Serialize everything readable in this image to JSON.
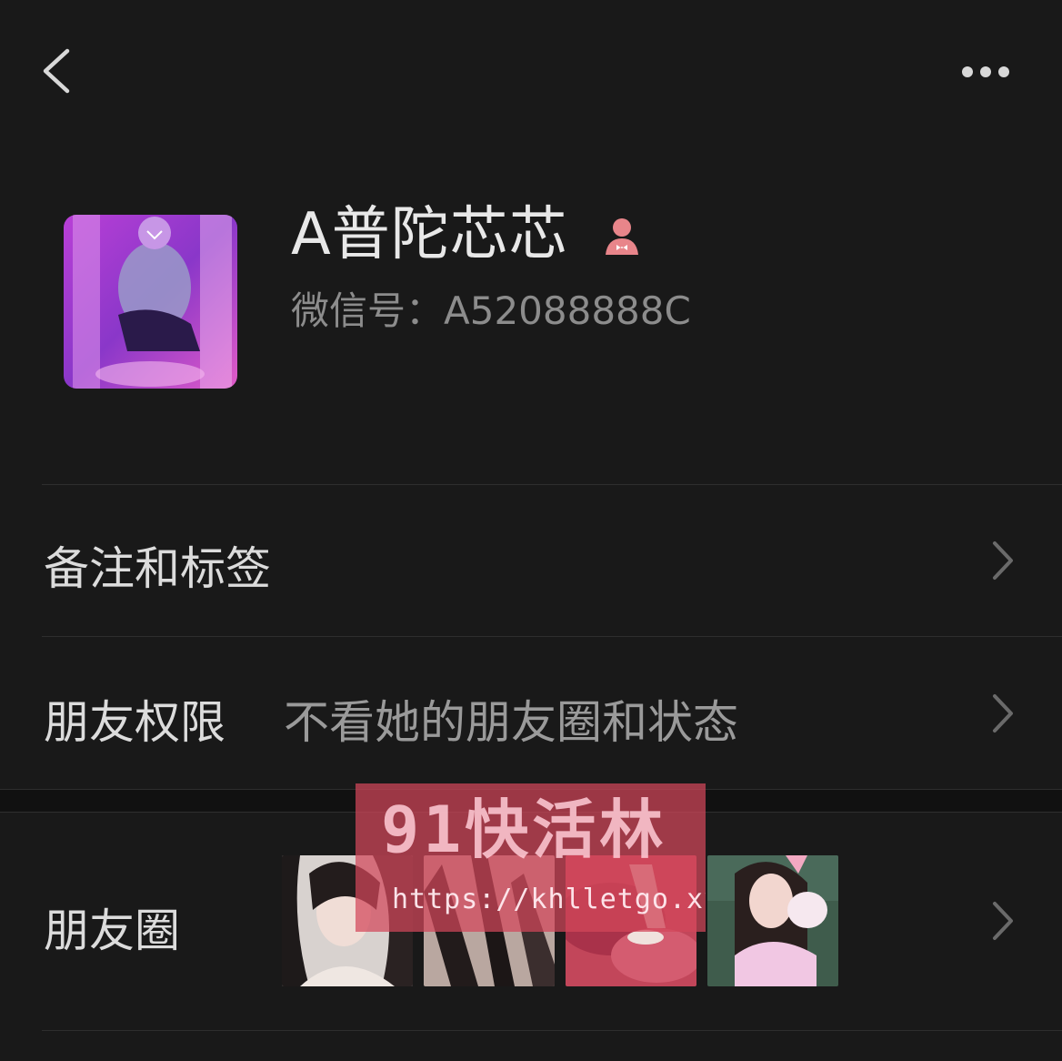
{
  "header": {
    "back_icon": "chevron-left-icon",
    "more_icon": "more-horizontal-icon"
  },
  "profile": {
    "nickname": "A普陀芯芯",
    "gender_icon": "female-icon",
    "wechat_id": "微信号：A52088888C"
  },
  "rows": [
    {
      "label": "备注和标签",
      "value": ""
    },
    {
      "label": "朋友权限",
      "value": "不看她的朋友圈和状态"
    },
    {
      "label": "朋友圈",
      "value": ""
    }
  ],
  "watermark": {
    "title": "91快活林",
    "url": "https://khlletgo.xyz"
  },
  "colors": {
    "background": "#191919",
    "divider": "#2e2e2e",
    "gender_icon": "#e8858a",
    "watermark": "#d2465a"
  }
}
